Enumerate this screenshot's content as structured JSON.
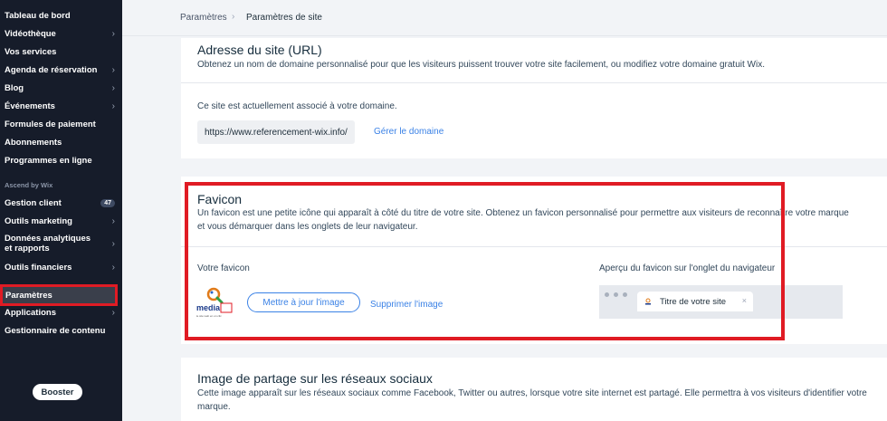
{
  "sidebar": {
    "items": [
      {
        "label": "Tableau de bord"
      },
      {
        "label": "Vidéothèque"
      },
      {
        "label": "Vos services"
      },
      {
        "label": "Agenda de réservation"
      },
      {
        "label": "Blog"
      },
      {
        "label": "Événements"
      },
      {
        "label": "Formules de paiement"
      },
      {
        "label": "Abonnements"
      },
      {
        "label": "Programmes en ligne"
      }
    ],
    "section_label": "Ascend by Wix",
    "ascend_items": [
      {
        "label": "Gestion client",
        "badge": "47"
      },
      {
        "label": "Outils marketing"
      },
      {
        "label": "Données analytiques et rapports"
      },
      {
        "label": "Outils financiers"
      }
    ],
    "bottom_items": [
      {
        "label": "Paramètres"
      },
      {
        "label": "Applications"
      },
      {
        "label": "Gestionnaire de contenu"
      }
    ],
    "booster_label": "Booster"
  },
  "breadcrumb": {
    "parent": "Paramètres",
    "current": "Paramètres de site"
  },
  "domain_card": {
    "title": "Adresse du site (URL)",
    "description": "Obtenez un nom de domaine personnalisé pour que les visiteurs puissent trouver votre site facilement, ou modifiez votre domaine gratuit Wix.",
    "info": "Ce site est actuellement associé à votre domaine.",
    "url": "https://www.referencement-wix.info/",
    "manage_link": "Gérer le domaine"
  },
  "favicon_card": {
    "title": "Favicon",
    "description": "Un favicon est une petite icône qui apparaît à côté du titre de votre site. Obtenez un favicon personnalisé pour permettre aux visiteurs de reconnaître votre marque et vous démarquer dans les onglets de leur navigateur.",
    "your_favicon_label": "Votre favicon",
    "preview_label": "Aperçu du favicon sur l'onglet du navigateur",
    "update_button": "Mettre à jour l'image",
    "delete_link": "Supprimer l'image",
    "tab_title": "Titre de votre site",
    "tab_close": "×",
    "logo_text": "media",
    "logo_subtext": "le site web en un clic"
  },
  "social_card": {
    "title": "Image de partage sur les réseaux sociaux",
    "description": "Cette image apparaît sur les réseaux sociaux comme Facebook, Twitter ou autres, lorsque votre site internet est partagé. Elle permettra à vos visiteurs d'identifier votre marque."
  },
  "colors": {
    "sidebar_bg": "#161c2a",
    "accent_blue": "#3b82e6",
    "highlight_red": "#e01b24"
  },
  "icons": {
    "chevron": "chevron-right-icon",
    "breadcrumb_sep": "chevron-right-icon",
    "close": "close-icon"
  }
}
